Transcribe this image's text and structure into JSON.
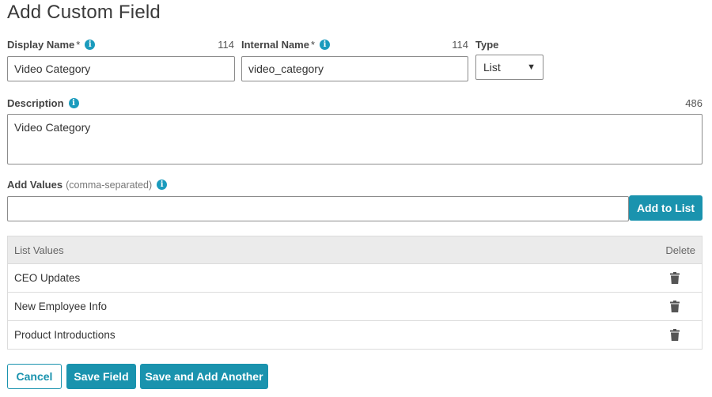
{
  "page": {
    "title": "Add Custom Field"
  },
  "display_name": {
    "label": "Display Name",
    "required_mark": "*",
    "count": "114",
    "value": "Video Category"
  },
  "internal_name": {
    "label": "Internal Name",
    "required_mark": "*",
    "count": "114",
    "value": "video_category"
  },
  "type": {
    "label": "Type",
    "selected": "List"
  },
  "description": {
    "label": "Description",
    "count": "486",
    "value": "Video Category"
  },
  "add_values": {
    "label": "Add Values",
    "hint": "(comma-separated)",
    "value": "",
    "button_label": "Add to List"
  },
  "list_table": {
    "col_values": "List Values",
    "col_delete": "Delete",
    "rows": [
      {
        "label": "CEO Updates"
      },
      {
        "label": "New Employee Info"
      },
      {
        "label": "Product Introductions"
      }
    ]
  },
  "actions": {
    "cancel_label": "Cancel",
    "save_label": "Save Field",
    "save_another_label": "Save and Add Another"
  },
  "colors": {
    "accent": "#1a93ae",
    "info": "#1a9bbd"
  }
}
